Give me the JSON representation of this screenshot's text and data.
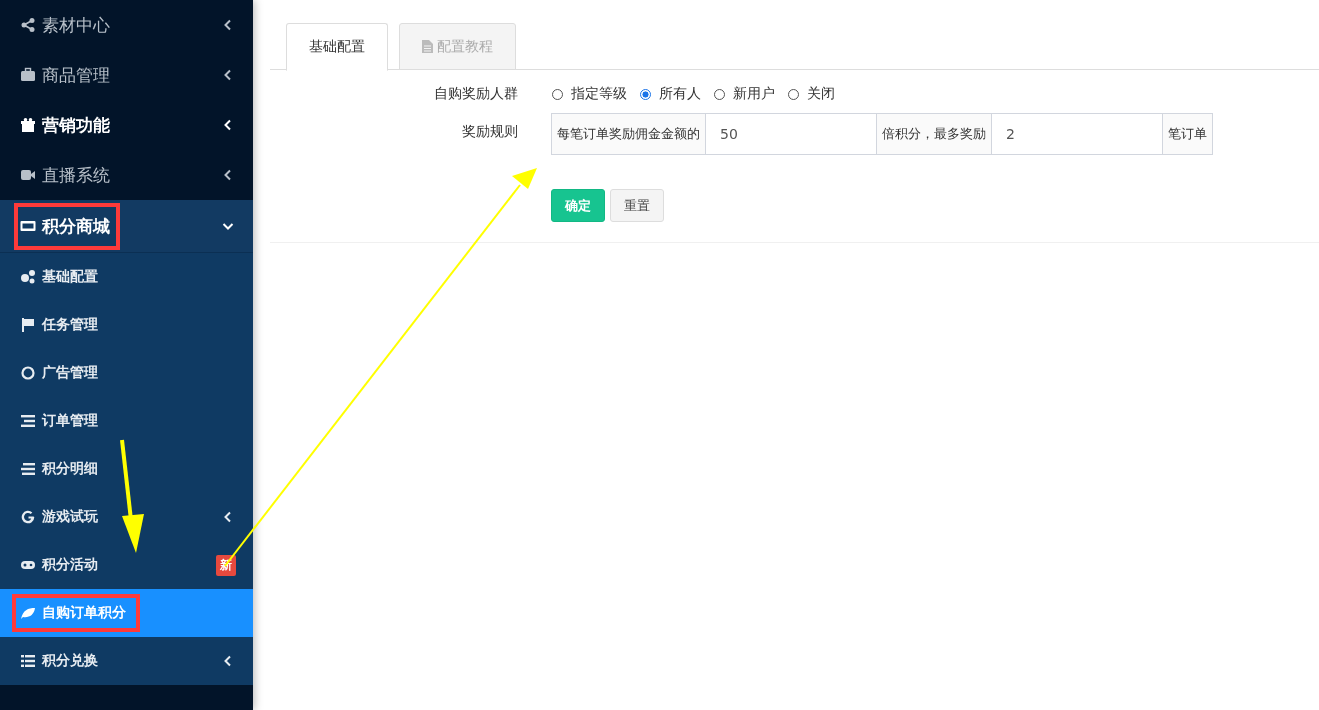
{
  "sidebar": {
    "items": [
      {
        "label": "素材中心",
        "emphasized": false,
        "highlighted": false,
        "expanded": false,
        "has_submenu": true
      },
      {
        "label": "商品管理",
        "emphasized": false,
        "highlighted": false,
        "expanded": false,
        "has_submenu": true
      },
      {
        "label": "营销功能",
        "emphasized": true,
        "highlighted": false,
        "expanded": false,
        "has_submenu": true
      },
      {
        "label": "直播系统",
        "emphasized": false,
        "highlighted": false,
        "expanded": false,
        "has_submenu": true
      },
      {
        "label": "积分商城",
        "emphasized": true,
        "highlighted": true,
        "expanded": true,
        "has_submenu": true,
        "children": [
          {
            "label": "基础配置",
            "selected": false,
            "highlighted": false,
            "has_submenu": false
          },
          {
            "label": "任务管理",
            "selected": false,
            "highlighted": false,
            "has_submenu": false
          },
          {
            "label": "广告管理",
            "selected": false,
            "highlighted": false,
            "has_submenu": false
          },
          {
            "label": "订单管理",
            "selected": false,
            "highlighted": false,
            "has_submenu": false
          },
          {
            "label": "积分明细",
            "selected": false,
            "highlighted": false,
            "has_submenu": false
          },
          {
            "label": "游戏试玩",
            "selected": false,
            "highlighted": false,
            "has_submenu": true
          },
          {
            "label": "积分活动",
            "selected": false,
            "highlighted": false,
            "has_submenu": false,
            "badge": "新"
          },
          {
            "label": "自购订单积分",
            "selected": true,
            "highlighted": true,
            "has_submenu": false
          },
          {
            "label": "积分兑换",
            "selected": false,
            "highlighted": false,
            "has_submenu": true
          }
        ]
      }
    ]
  },
  "tabs": [
    {
      "label": "基础配置",
      "selected": true
    },
    {
      "label": "配置教程",
      "selected": false
    }
  ],
  "form": {
    "audience": {
      "label": "自购奖励人群",
      "options": [
        {
          "label": "指定等级",
          "selected": false
        },
        {
          "label": "所有人",
          "selected": true
        },
        {
          "label": "新用户",
          "selected": false
        },
        {
          "label": "关闭",
          "selected": false
        }
      ]
    },
    "reward_rule": {
      "label": "奖励规则",
      "parts": [
        {
          "kind": "addon",
          "text": "每笔订单奖励佣金金额的"
        },
        {
          "kind": "input",
          "value": "50"
        },
        {
          "kind": "addon",
          "text": "倍积分，最多奖励"
        },
        {
          "kind": "input",
          "value": "2"
        },
        {
          "kind": "addon",
          "text": "笔订单"
        }
      ]
    },
    "buttons": [
      {
        "label": "确定",
        "kind": "primary"
      },
      {
        "label": "重置",
        "kind": "default"
      }
    ]
  }
}
